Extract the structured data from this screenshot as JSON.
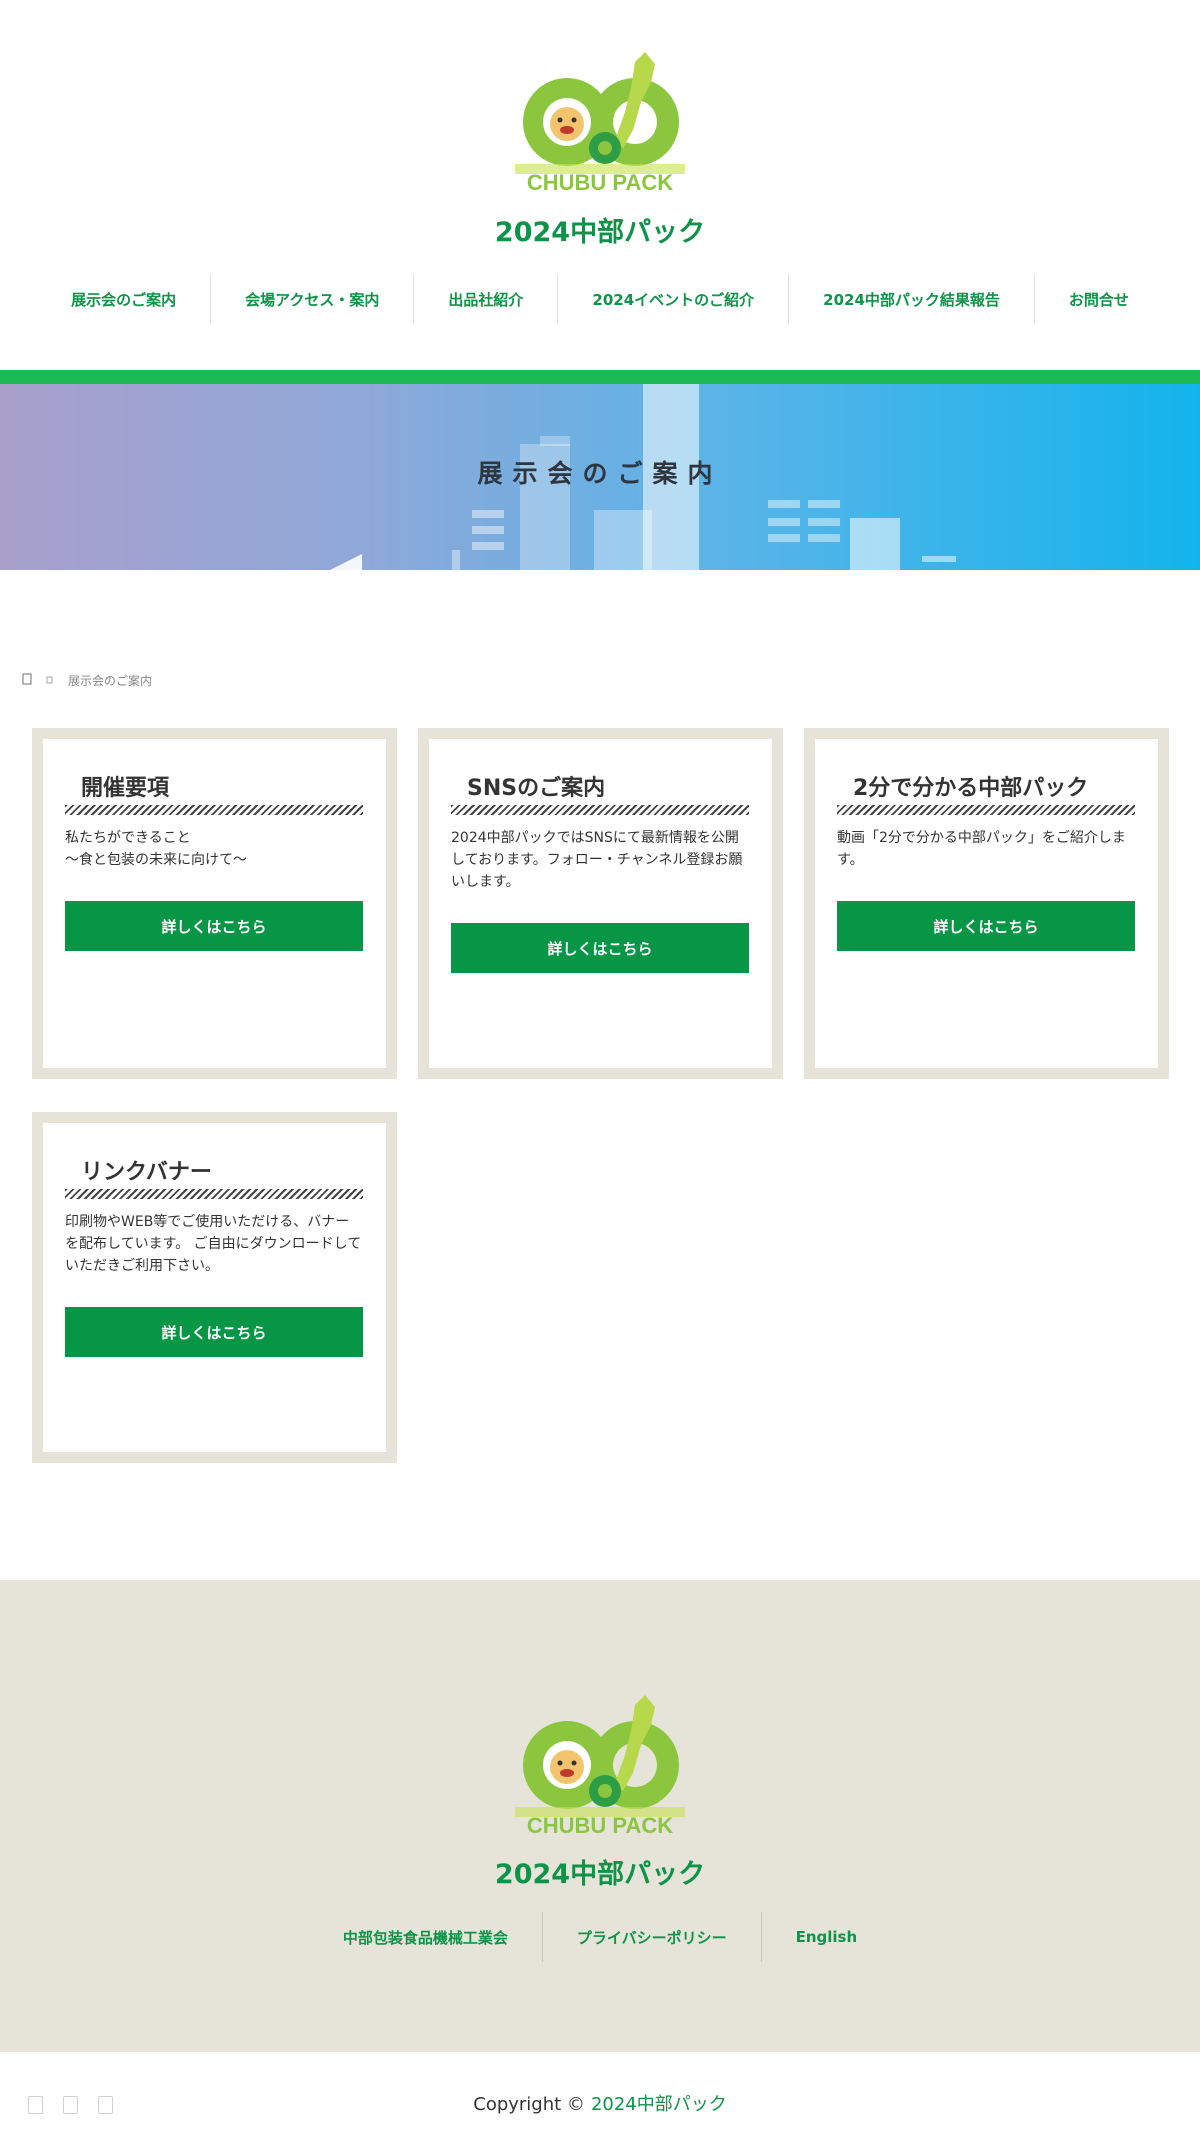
{
  "header": {
    "logo_text": "CHUBU PACK",
    "site_title": "2024中部パック",
    "nav": [
      {
        "label": "展示会のご案内"
      },
      {
        "label": "会場アクセス・案内"
      },
      {
        "label": "出品社紹介"
      },
      {
        "label": "2024イベントのご紹介"
      },
      {
        "label": "2024中部パック結果報告"
      },
      {
        "label": "お問合せ"
      }
    ]
  },
  "hero": {
    "title": "展示会のご案内"
  },
  "breadcrumb": {
    "home_icon": "home-icon",
    "separator_icon": "chevron-right-icon",
    "current": "展示会のご案内"
  },
  "cards": [
    {
      "title": "開催要項",
      "text": "私たちができること\n〜食と包装の未来に向けて〜",
      "button": "詳しくはこちら"
    },
    {
      "title": "SNSのご案内",
      "text": "2024中部パックではSNSにて最新情報を公開しております。フォロー・チャンネル登録お願いします。",
      "button": "詳しくはこちら"
    },
    {
      "title": "2分で分かる中部パック",
      "text": "動画「2分で分かる中部パック」をご紹介します。",
      "button": "詳しくはこちら"
    },
    {
      "title": "リンクバナー",
      "text": "印刷物やWEB等でご使用いただける、バナーを配布しています。 ご自由にダウンロードしていただきご利用下さい。",
      "button": "詳しくはこちら"
    }
  ],
  "footer": {
    "logo_text": "CHUBU PACK",
    "site_title": "2024中部パック",
    "links": [
      {
        "label": "中部包装食品機械工業会"
      },
      {
        "label": "プライバシーポリシー"
      },
      {
        "label": "English"
      }
    ],
    "copyright_prefix": "Copyright ©",
    "copyright_site": "2024中部パック",
    "social_icons": [
      "facebook-icon",
      "twitter-icon",
      "youtube-icon"
    ]
  },
  "colors": {
    "brand_green": "#0d9448",
    "button_green": "#079546",
    "accent_bar": "#1db954",
    "card_border": "#e6e3d9",
    "footer_bg": "#e6e3d9"
  }
}
